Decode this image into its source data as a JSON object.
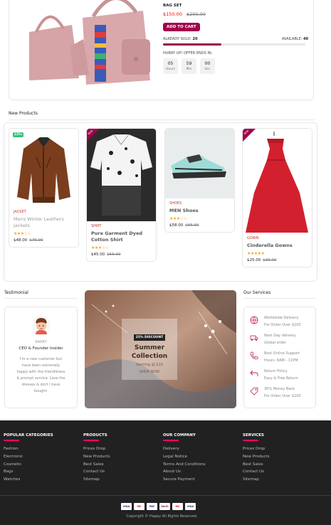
{
  "deal": {
    "name": "BAG SET",
    "price_new": "$150.00",
    "price_old": "$200.00",
    "add_to_cart": "ADD TO CART",
    "sold_label": "ALREADY SOLD:",
    "sold_value": "20",
    "available_label": "AVAILABLE:",
    "available_value": "40",
    "sold_fraction": 0.41,
    "hurry_text": "HURRY UP! OFFER ENDS IN:",
    "countdown": [
      {
        "value": "05",
        "unit": "Hours"
      },
      {
        "value": "59",
        "unit": "Min"
      },
      {
        "value": "00",
        "unit": "Sec"
      }
    ]
  },
  "new_products": {
    "title": "New Products",
    "items": [
      {
        "badge": "15%",
        "badge_type": "sale",
        "category": "JACKET",
        "name": "Mens Winter Leathers Jackets",
        "stars": "★★★☆☆",
        "price": "$48.00",
        "old_price": "$75.00"
      },
      {
        "badge": "NEW",
        "badge_type": "new",
        "category": "SHIRT",
        "name": "Pure Garment Dyed Cotton Shirt",
        "stars": "★★★☆☆",
        "price": "$45.00",
        "old_price": "$56.00"
      },
      {
        "badge": "",
        "badge_type": "none",
        "category": "SHOES",
        "name": "MEN Shoes",
        "stars": "★★★☆☆",
        "price": "$58.00",
        "old_price": "$65.00"
      },
      {
        "badge": "NEW",
        "badge_type": "new",
        "category": "GOWN",
        "name": "Cinderella Gowns",
        "stars": "★★★★★",
        "price": "$25.00",
        "old_price": "$35.00"
      }
    ]
  },
  "testimonial": {
    "title": "Testimonial",
    "name": "KARRY",
    "role": "CEO & Founder Insider",
    "quote": "I'm a new customer but have been extremely happy with the friendliness & prompt service. Love the dresses & skirt I have bought."
  },
  "banner": {
    "discount": "25% DISCOUNT",
    "title": "Summer Collection",
    "subtitle": "Starting @ $10",
    "cta": "SHOP NOW"
  },
  "services": {
    "title": "Our Services",
    "items": [
      {
        "icon": "truck-icon",
        "title": "Worldwide Delivery",
        "subtitle": "For Order Over $100"
      },
      {
        "icon": "globe-icon",
        "title": "Next Day delivery",
        "subtitle": "Global order"
      },
      {
        "icon": "phone-icon",
        "title": "Best Online Support",
        "subtitle": "Hours: 8AM - 11PM"
      },
      {
        "icon": "return-icon",
        "title": "Return Policy",
        "subtitle": "Easy & Free Return"
      },
      {
        "icon": "tag-icon",
        "title": "30% Money Back",
        "subtitle": "For Order Over $100"
      }
    ]
  },
  "footer": {
    "columns": [
      {
        "heading": "POPULAR CATEGORIES",
        "links": [
          "Fashion",
          "Electronic",
          "Cosmetic",
          "Bags",
          "Watches"
        ]
      },
      {
        "heading": "PRODUCTS",
        "links": [
          "Prices Drop",
          "New Products",
          "Best Sales",
          "Contact Us",
          "Sitemap"
        ]
      },
      {
        "heading": "OUR COMPANY",
        "links": [
          "Delivery",
          "Legal Notice",
          "Terms And Conditions",
          "About Us",
          "Secure Payment"
        ]
      },
      {
        "heading": "SERVICES",
        "links": [
          "Prices Drop",
          "New Products",
          "Best Sales",
          "Contact Us",
          "Sitemap"
        ]
      }
    ],
    "payments": [
      "VISA",
      "MC",
      "PAY",
      "Skrill",
      "MC",
      "VISA"
    ],
    "copyright": "Copyright © Happy All Rights Reserved."
  },
  "colors": {
    "accent": "#a0004b",
    "price": "#ff0000",
    "stars": "#f5a623",
    "footer_bg": "#212121",
    "footer_accent": "#ff0066"
  }
}
